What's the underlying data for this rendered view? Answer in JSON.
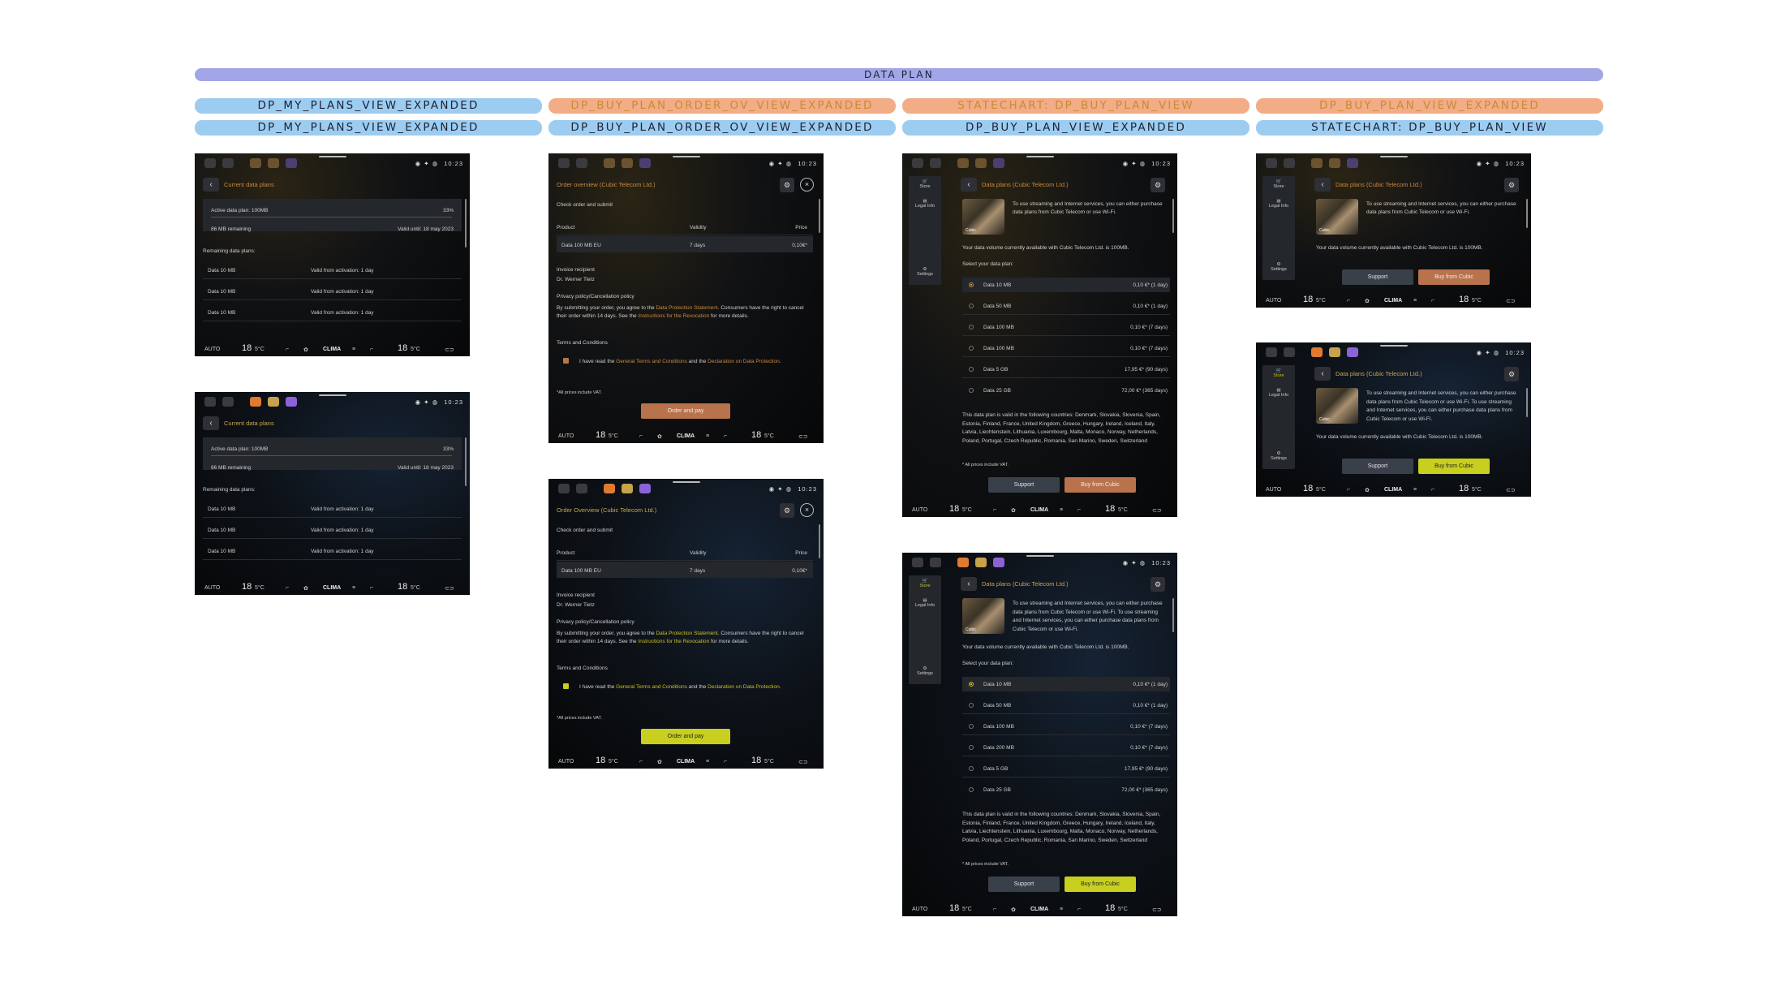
{
  "header": {
    "main": "DATA PLAN"
  },
  "columns": [
    {
      "top_label": "DP_MY_PLANS_VIEW_EXPANDED",
      "sub_label": "DP_MY_PLANS_VIEW_EXPANDED"
    },
    {
      "top_label": "DP_BUY_PLAN_ORDER_OV_VIEW_EXPANDED",
      "sub_label": "DP_BUY_PLAN_ORDER_OV_VIEW_EXPANDED"
    },
    {
      "top_label": "STATECHART: DP_BUY_PLAN_VIEW",
      "sub_label": "DP_BUY_PLAN_VIEW_EXPANDED"
    },
    {
      "top_label": "DP_BUY_PLAN_VIEW_EXPANDED",
      "sub_label": "STATECHART: DP_BUY_PLAN_VIEW"
    }
  ],
  "common": {
    "time": "10:23",
    "auto": "AUTO",
    "clima": "CLIMA",
    "temp_big": "18",
    "temp_small": "5°C",
    "back": "‹"
  },
  "my_plans": {
    "title": "Current data plans",
    "active_plan": "Active data plan: 100MB",
    "active_pct": "33%",
    "remaining": "86 MB remaining",
    "valid_until": "Valid until: 18 may 2023",
    "remaining_label": "Remaining data plans:",
    "rows": [
      {
        "name": "Data 10 MB",
        "validity": "Valid from activation: 1 day"
      },
      {
        "name": "Data 10 MB",
        "validity": "Valid from activation: 1 day"
      },
      {
        "name": "Data 10 MB",
        "validity": "Valid from activation: 1 day"
      }
    ]
  },
  "order": {
    "title_a": "Order overview (Cubic Telecom Ltd.)",
    "title_b": "Order Overview (Cubic Telecom Ltd.)",
    "check": "Check order and submit",
    "col_product": "Product",
    "col_validity": "Validity",
    "col_price": "Price",
    "product": "Data 100 MB EU",
    "validity": "7 days",
    "price": "0,10€*",
    "invoice": "Invoice recipient",
    "recipient": "Dr. Werner Tietz",
    "privacy": "Privacy policy/Cancellation policy",
    "submit_1": "By submitting your order, you agree to the ",
    "dps_link": "Data Protection Statement",
    "submit_2": ". Consumers have the right to cancel their order within 14 days. See the ",
    "revoc_link": "Instructions for the Revocation",
    "submit_3": " for more details.",
    "terms_head": "Terms and Conditions",
    "agree_1": "I have read the ",
    "gtc_link": "General Terms and Conditions",
    "agree_2": " and the ",
    "decl_link": "Declaration on Data Protection",
    "agree_3": ".",
    "vat": "*All prices include VAT.",
    "order_btn": "Order and pay"
  },
  "buy": {
    "title": "Data plans (Cubic Telecom Ltd.)",
    "intro_short": "To use streaming and Internet services, you can either purchase data plans from Cubic Telecom or use Wi-Fi.",
    "intro_long": "To use streaming and Internet services, you can either purchase data plans from Cubic Telecom or use Wi-Fi. To use streaming and Internet services, you can either purchase data plans from Cubic Telecom or use Wi-Fi.",
    "volume": "Your data volume currently available with Cubic Telecom Ltd. is 100MB.",
    "select": "Select your data plan:",
    "plans_a": [
      {
        "name": "Data 10 MB",
        "price": "0,10 €* (1 day)"
      },
      {
        "name": "Data 50 MB",
        "price": "0,10 €* (1 day)"
      },
      {
        "name": "Data 100 MB",
        "price": "0,10 €* (7 days)"
      },
      {
        "name": "Data 100 MB",
        "price": "0,10 €* (7 days)"
      },
      {
        "name": "Data 5 GB",
        "price": "17,95 €* (90 days)"
      },
      {
        "name": "Data 25 GB",
        "price": "72,00 €* (365 days)"
      }
    ],
    "plans_b": [
      {
        "name": "Data 10 MB",
        "price": "0,10 €* (1 day)"
      },
      {
        "name": "Data 50 MB",
        "price": "0,10 €* (1 day)"
      },
      {
        "name": "Data 100 MB",
        "price": "0,10 €* (7 days)"
      },
      {
        "name": "Data 200 MB",
        "price": "0,10 €* (7 days)"
      },
      {
        "name": "Data 5 GB",
        "price": "17,95 €* (90 days)"
      },
      {
        "name": "Data 25 GB",
        "price": "72,00 €* (365 days)"
      }
    ],
    "countries": "This data plan is valid in the following countries: Denmark, Slovakia, Slovenia, Spain, Estonia, Finland, France, United Kingdom, Greece, Hungary, Ireland, Iceland, Italy, Latvia, Liechtenstein, Lithuania, Luxembourg, Malta, Monaco, Norway, Netherlands, Poland, Portugal, Czech Republic, Romania, San Marino, Sweden, Switzerland",
    "vat": "* All prices include VAT.",
    "support": "Support",
    "buy_btn_a": "Buy from Cubic",
    "buy_btn_b": "Buy from Cubic",
    "store": "Store",
    "legal": "Legal Info",
    "settings": "Settings",
    "thumb_label": "Cubic"
  },
  "colors": {
    "accent_orange": "#c98a3a",
    "accent_yellow": "#c8cf1e",
    "pill_blue": "#9dccf1",
    "pill_orange": "#f2ad86",
    "pill_main": "#a3a6e6"
  }
}
